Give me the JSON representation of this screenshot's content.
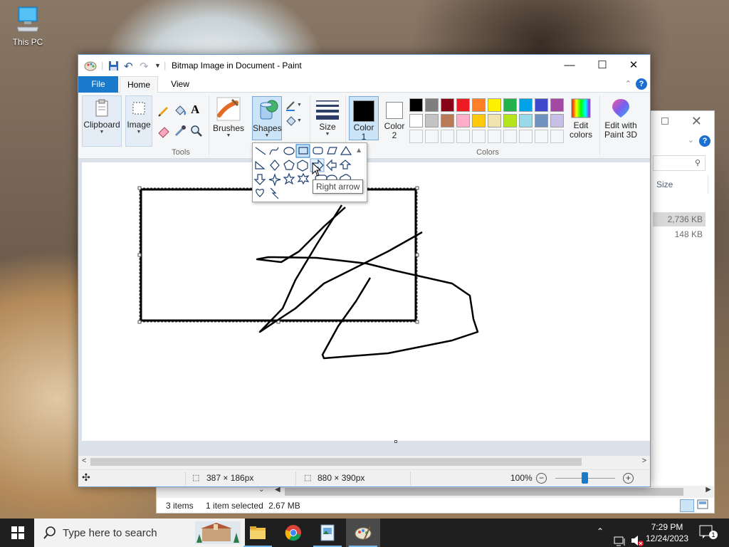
{
  "desktop": {
    "icon_label": "This PC"
  },
  "explorer": {
    "size_header": "Size",
    "rows": [
      "2,736 KB",
      "148 KB"
    ],
    "status": {
      "items": "3 items",
      "selected": "1 item selected",
      "size": "2.67 MB"
    }
  },
  "paint": {
    "title": "Bitmap Image in Document - Paint",
    "tabs": {
      "file": "File",
      "home": "Home",
      "view": "View"
    },
    "ribbon": {
      "clipboard": "Clipboard",
      "image": "Image",
      "tools_group": "Tools",
      "brushes": "Brushes",
      "shapes": "Shapes",
      "size": "Size",
      "color1": "Color",
      "color1_num": "1",
      "color2": "Color",
      "color2_num": "2",
      "colors_group": "Colors",
      "edit_colors_1": "Edit",
      "edit_colors_2": "colors",
      "paint3d_1": "Edit with",
      "paint3d_2": "Paint 3D"
    },
    "colors": {
      "color1": "#000000",
      "color2": "#ffffff",
      "palette_row1": [
        "#000000",
        "#7f7f7f",
        "#880015",
        "#ed1c24",
        "#ff7f27",
        "#fff200",
        "#22b14c",
        "#00a2e8",
        "#3f48cc",
        "#a349a4"
      ],
      "palette_row2": [
        "#ffffff",
        "#c3c3c3",
        "#b97a57",
        "#ffaec9",
        "#ffc90e",
        "#efe4b0",
        "#b5e61d",
        "#99d9ea",
        "#7092be",
        "#c8bfe7"
      ]
    },
    "tooltip": "Right arrow",
    "status": {
      "selection": "387 × 186px",
      "canvas_size": "880 × 390px",
      "zoom": "100%"
    }
  },
  "taskbar": {
    "search_placeholder": "Type here to search",
    "time": "7:29 PM",
    "date": "12/24/2023",
    "notification_count": "1"
  }
}
